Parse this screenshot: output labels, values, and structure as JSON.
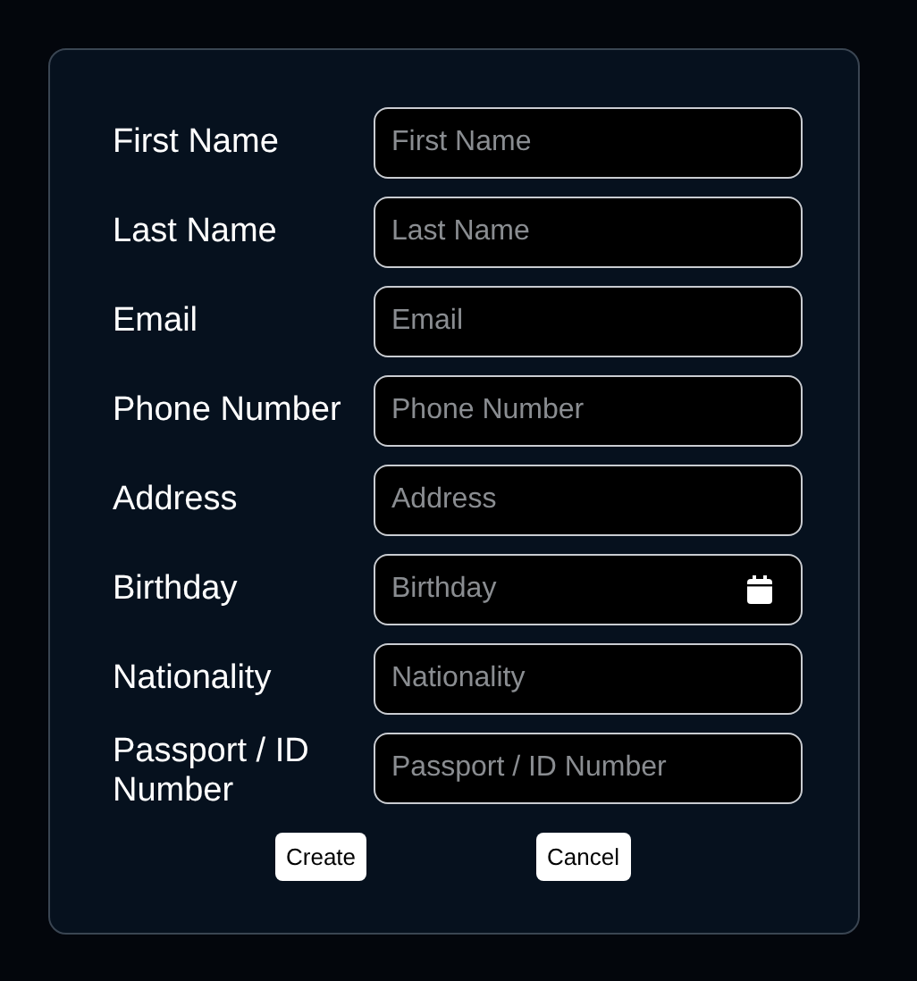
{
  "form": {
    "fields": [
      {
        "label": "First Name",
        "placeholder": "First Name",
        "kind": "text"
      },
      {
        "label": "Last Name",
        "placeholder": "Last Name",
        "kind": "text"
      },
      {
        "label": "Email",
        "placeholder": "Email",
        "kind": "text"
      },
      {
        "label": "Phone Number",
        "placeholder": "Phone Number",
        "kind": "text"
      },
      {
        "label": "Address",
        "placeholder": "Address",
        "kind": "text"
      },
      {
        "label": "Birthday",
        "placeholder": "Birthday",
        "kind": "date"
      },
      {
        "label": "Nationality",
        "placeholder": "Nationality",
        "kind": "text"
      },
      {
        "label": "Passport / ID Number",
        "placeholder": "Passport / ID Number",
        "kind": "text"
      }
    ],
    "buttons": [
      "Create",
      "Cancel"
    ]
  }
}
